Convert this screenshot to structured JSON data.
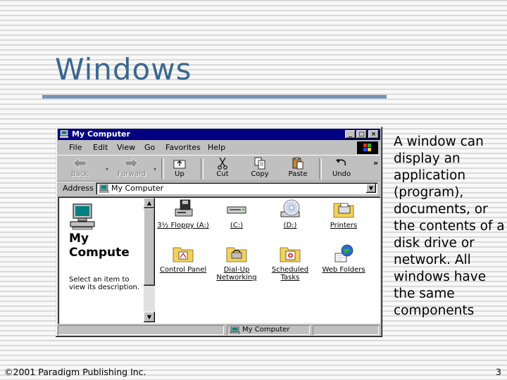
{
  "slide": {
    "title": "Windows",
    "body_text": "A window can display an application (program), documents, or the contents of a disk drive or network. All windows have the same components",
    "footer_left": "©2001 Paradigm Publishing Inc.",
    "page_number": "3"
  },
  "window": {
    "title": "My Computer",
    "title_icon": "computer-icon",
    "caption_buttons": {
      "minimize": "_",
      "maximize": "□",
      "close": "×"
    },
    "menu": [
      "File",
      "Edit",
      "View",
      "Go",
      "Favorites",
      "Help"
    ],
    "toolbar": {
      "back": "Back",
      "forward": "Forward",
      "up": "Up",
      "cut": "Cut",
      "copy": "Copy",
      "paste": "Paste",
      "undo": "Undo",
      "more": "»"
    },
    "address": {
      "label": "Address",
      "value": "My Computer"
    },
    "left_pane": {
      "title_line1": "My",
      "title_line2": "Compute",
      "description": "Select an item to view its description."
    },
    "icons": [
      {
        "label": "3½ Floppy (A:)",
        "icon": "floppy-drive-icon"
      },
      {
        "label": "(C:)",
        "icon": "hard-drive-icon"
      },
      {
        "label": "(D:)",
        "icon": "cd-drive-icon"
      },
      {
        "label": "Printers",
        "icon": "printers-folder-icon"
      },
      {
        "label": "Control Panel",
        "icon": "control-panel-folder-icon"
      },
      {
        "label": "Dial-Up Networking",
        "icon": "dialup-networking-folder-icon"
      },
      {
        "label": "Scheduled Tasks",
        "icon": "scheduled-tasks-folder-icon"
      },
      {
        "label": "Web Folders",
        "icon": "web-folders-icon"
      }
    ],
    "status": {
      "text": "My Computer"
    }
  },
  "colors": {
    "title_text": "#3a6790",
    "title_rule": "#7393b6",
    "window_face": "#c0c0c0",
    "titlebar": "#000080",
    "folder": "#f2d25a"
  }
}
